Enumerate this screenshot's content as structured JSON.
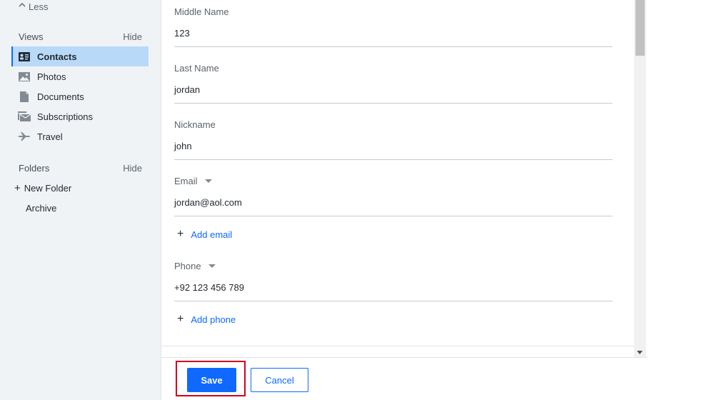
{
  "sidebar": {
    "less_label": "Less",
    "views": {
      "title": "Views",
      "hide_label": "Hide",
      "items": [
        {
          "label": "Contacts",
          "icon": "contact-card-icon",
          "active": true
        },
        {
          "label": "Photos",
          "icon": "image-icon",
          "active": false
        },
        {
          "label": "Documents",
          "icon": "document-icon",
          "active": false
        },
        {
          "label": "Subscriptions",
          "icon": "subscriptions-icon",
          "active": false
        },
        {
          "label": "Travel",
          "icon": "airplane-icon",
          "active": false
        }
      ]
    },
    "folders": {
      "title": "Folders",
      "hide_label": "Hide",
      "new_folder_label": "New Folder",
      "items": [
        {
          "label": "Archive"
        }
      ]
    }
  },
  "form": {
    "middle_name": {
      "label": "Middle Name",
      "value": "123"
    },
    "last_name": {
      "label": "Last Name",
      "value": "jordan"
    },
    "nickname": {
      "label": "Nickname",
      "value": "john"
    },
    "email": {
      "label": "Email",
      "value": "jordan@aol.com"
    },
    "add_email_label": "Add email",
    "phone": {
      "label": "Phone",
      "value": "+92 123 456 789"
    },
    "add_phone_label": "Add phone"
  },
  "footer": {
    "save_label": "Save",
    "cancel_label": "Cancel"
  },
  "colors": {
    "accent": "#0f69ff",
    "sidebar_bg": "#f0f3f5",
    "active_bg": "#b9d9f8",
    "highlight_border": "#d0021b"
  }
}
